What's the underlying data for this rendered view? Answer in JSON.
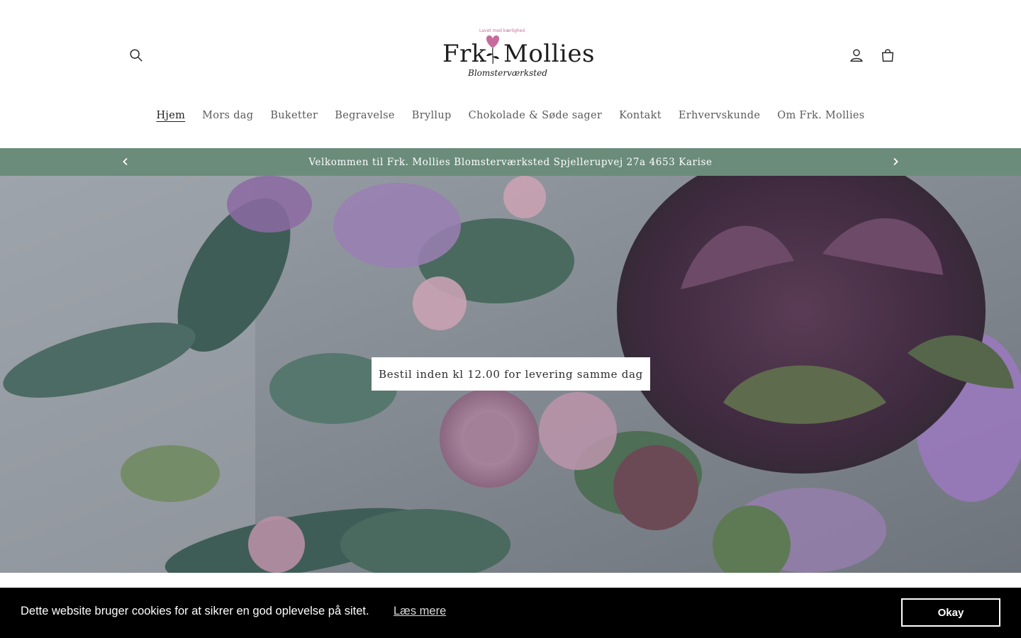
{
  "header": {
    "logo": {
      "name_left": "Frk",
      "name_right": "Mollies",
      "subtitle": "Blomsterværksted",
      "arc_text": "Lavet med kærlighed"
    },
    "icons": {
      "search": "search-icon",
      "account": "user-icon",
      "cart": "bag-icon"
    }
  },
  "nav": {
    "items": [
      {
        "label": "Hjem",
        "active": true
      },
      {
        "label": "Mors dag"
      },
      {
        "label": "Buketter"
      },
      {
        "label": "Begravelse"
      },
      {
        "label": "Bryllup"
      },
      {
        "label": "Chokolade & Søde sager"
      },
      {
        "label": "Kontakt"
      },
      {
        "label": "Erhvervskunde"
      },
      {
        "label": "Om Frk. Mollies"
      }
    ]
  },
  "announcement": {
    "message": "Velkommen til Frk. Mollies Blomsterværksted Spjellerupvej 27a 4653 Karise",
    "background": "#6b8c7b"
  },
  "hero": {
    "button_label": "Bestil inden kl 12.00 for levering samme dag"
  },
  "cookie": {
    "message": "Dette website bruger cookies for at sikrer en god oplevelse på sitet.",
    "link_label": "Læs mere",
    "accept_label": "Okay"
  },
  "colors": {
    "accent_green": "#6b8c7b",
    "logo_pink": "#c66b9a"
  }
}
